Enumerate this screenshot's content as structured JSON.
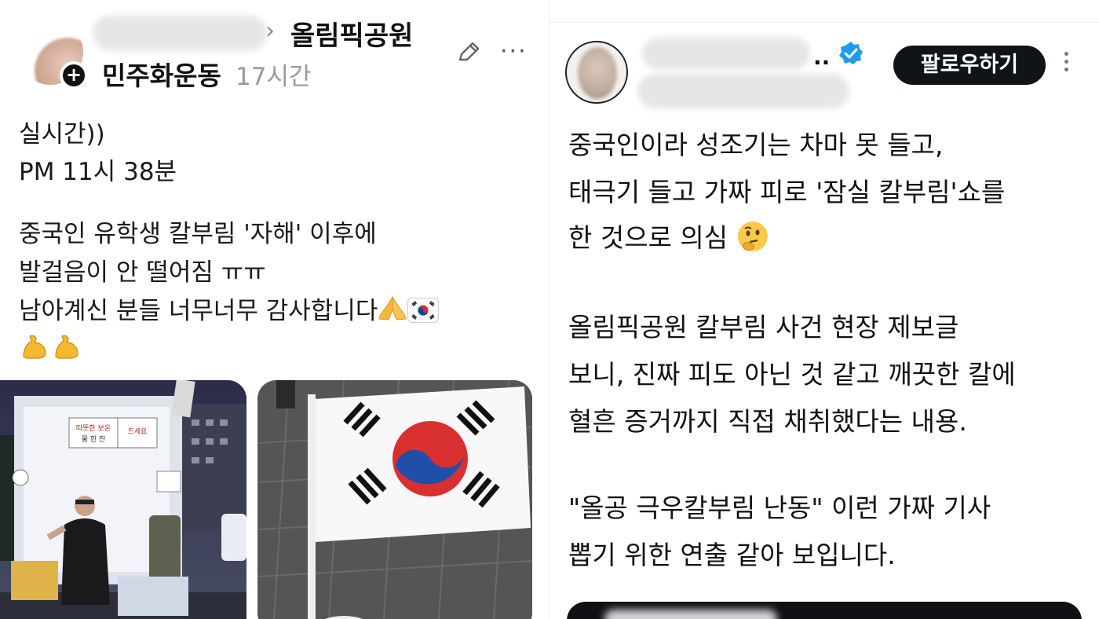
{
  "left_post": {
    "group_name": "올림픽공원",
    "username": "민주화운동",
    "time_ago": "17시간",
    "follow_plus": "+",
    "more": "···",
    "lines": [
      "실시간))",
      "PM 11시 38분",
      "",
      "중국인 유학생 칼부림 '자해' 이후에",
      "발걸음이 안 떨어짐 ㅠㅠ",
      "남아계신 분들 너무너무 감사합니다"
    ],
    "photo1_signs": [
      "따뜻한 보온",
      "물 한 잔",
      "드세요"
    ]
  },
  "right_post": {
    "name_suffix": "..",
    "follow_button": "팔로우하기",
    "paragraph1": [
      "중국인이라 성조기는 차마 못 들고,",
      "태극기 들고 가짜 피로 '잠실 칼부림'쇼를",
      "한 것으로 의심"
    ],
    "paragraph2": [
      "올림픽공원 칼부림 사건 현장 제보글",
      "보니, 진짜 피도 아닌 것 같고 깨끗한 칼에",
      "혈흔 증거까지 직접 채취했다는 내용."
    ],
    "paragraph3": [
      "\"올공 극우칼부림 난동\" 이런 가짜 기사",
      "뽑기 위한 연출 같아 보입니다."
    ]
  },
  "colors": {
    "follow_bg": "#0f1419",
    "verified": "#1d9bf0",
    "muted": "#9a9a9a"
  },
  "icons": [
    "edit-icon",
    "more-icon",
    "verified-icon",
    "kebab-icon",
    "pray-emoji",
    "korean-flag-emoji",
    "flexed-biceps-emoji",
    "thinking-face-emoji"
  ]
}
